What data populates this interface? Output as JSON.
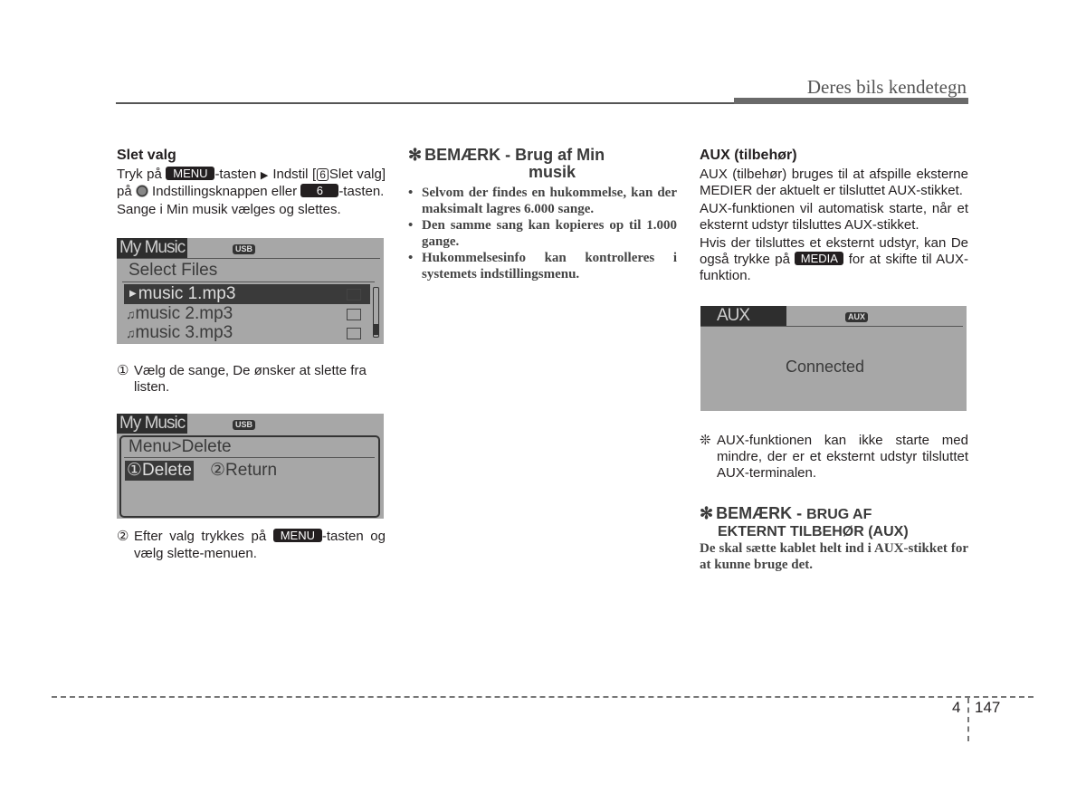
{
  "header": {
    "title": "Deres bils kendetegn"
  },
  "column1": {
    "heading": "Slet valg",
    "intro": {
      "part1": "Tryk på",
      "key_menu": "MENU",
      "part2": "-tasten",
      "arrow": "▶",
      "part3": "Indstil [",
      "boxed_number": "6",
      "part4": "Slet valg] på",
      "part5": "Indstillingsknappen eller",
      "key_6": "6",
      "part6": "-tasten."
    },
    "line2": "Sange i Min musik vælges og slettes.",
    "screen1": {
      "title": "My Music",
      "source_badge": "USB",
      "subtitle": "Select Files",
      "files": [
        {
          "icon": "play-icon",
          "glyph": "▶",
          "name": "music 1.mp3",
          "selected": true
        },
        {
          "icon": "music-note-icon",
          "glyph": "♫",
          "name": "music 2.mp3",
          "selected": false
        },
        {
          "icon": "music-note-icon",
          "glyph": "♫",
          "name": "music 3.mp3",
          "selected": false
        }
      ]
    },
    "step1": {
      "num": "①",
      "text": "Vælg de sange, De ønsker at slette fra listen."
    },
    "screen2": {
      "title": "My Music",
      "source_badge": "USB",
      "breadcrumb": "Menu>Delete",
      "options": [
        {
          "num": "①",
          "label": "Delete",
          "selected": true
        },
        {
          "num": "②",
          "label": "Return",
          "selected": false
        }
      ]
    },
    "step2": {
      "num": "②",
      "part1": "Efter valg trykkes på",
      "key": "MENU",
      "part2": "-tasten og vælg slette-menuen."
    }
  },
  "column2": {
    "note_star": "✻",
    "note_heading_line1": "BEMÆRK - Brug af Min",
    "note_heading_line2": "musik",
    "bullets": [
      "Selvom der findes en hukommelse, kan der maksimalt lagres 6.000 sange.",
      "Den samme sang kan kopieres op til 1.000 gange.",
      "Hukommelsesinfo kan kontrolleres i systemets indstillingsmenu."
    ]
  },
  "column3": {
    "heading": "AUX (tilbehør)",
    "para1": "AUX (tilbehør) bruges til at afspille eksterne MEDIER der aktuelt er tilsluttet AUX-stikket.",
    "para2": "AUX-funktionen vil automatisk starte, når et eksternt udstyr tilsluttes AUX-stikket.",
    "para3": {
      "part1": "Hvis der tilsluttes et eksternt udstyr, kan De også trykke på",
      "key": "MEDIA",
      "part2": "for at skifte til AUX-funktion."
    },
    "screen3": {
      "title": "AUX",
      "source_badge": "AUX",
      "status": "Connected"
    },
    "footnote": {
      "mark": "❊",
      "text": "AUX-funktionen kan ikke starte med mindre, der er et eksternt udstyr tilsluttet AUX-terminalen."
    },
    "note2": {
      "star": "✻",
      "heading_line1_big": "BEMÆRK - ",
      "heading_line1_small": "BRUG AF",
      "heading_line2": "EKTERNT TILBEHØR (AUX)",
      "text": "De skal sætte kablet helt ind i AUX-stikket for at kunne bruge det."
    }
  },
  "footer": {
    "chapter": "4",
    "page": "147"
  }
}
